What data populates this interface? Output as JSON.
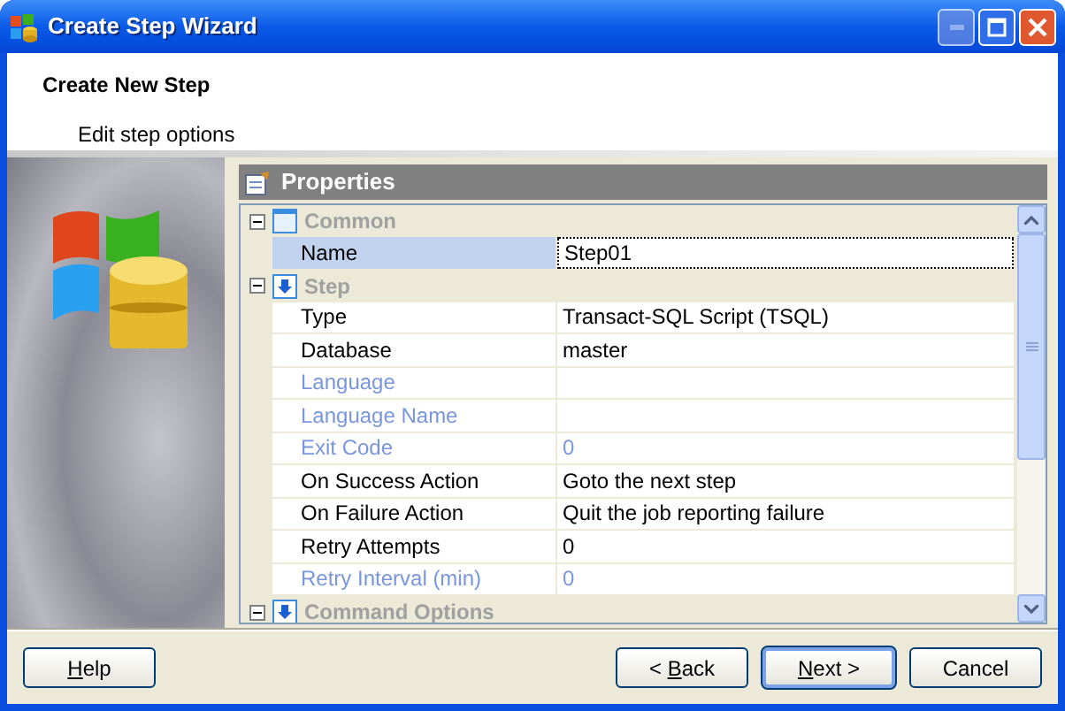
{
  "window": {
    "title": "Create Step Wizard",
    "title_buttons": [
      {
        "kind": "minimize",
        "disabled": true
      },
      {
        "kind": "maximize",
        "disabled": false
      },
      {
        "kind": "close",
        "disabled": false
      }
    ]
  },
  "header": {
    "title": "Create New Step",
    "subtitle": "Edit step options"
  },
  "properties": {
    "title": "Properties",
    "rows": [
      {
        "kind": "category",
        "label": "Common",
        "expanded": true
      },
      {
        "kind": "property",
        "label": "Name",
        "value": "Step01",
        "disabled": false,
        "selected": true
      },
      {
        "kind": "category",
        "label": "Step",
        "expanded": true
      },
      {
        "kind": "property",
        "label": "Type",
        "value": "Transact-SQL Script (TSQL)",
        "disabled": false,
        "selected": false
      },
      {
        "kind": "property",
        "label": "Database",
        "value": "master",
        "disabled": false,
        "selected": false
      },
      {
        "kind": "property",
        "label": "Language",
        "value": "",
        "disabled": true,
        "selected": false
      },
      {
        "kind": "property",
        "label": "Language Name",
        "value": "",
        "disabled": true,
        "selected": false
      },
      {
        "kind": "property",
        "label": "Exit Code",
        "value": "0",
        "disabled": true,
        "selected": false
      },
      {
        "kind": "property",
        "label": "On Success Action",
        "value": "Goto the next step",
        "disabled": false,
        "selected": false
      },
      {
        "kind": "property",
        "label": "On Failure Action",
        "value": "Quit the job reporting failure",
        "disabled": false,
        "selected": false
      },
      {
        "kind": "property",
        "label": "Retry Attempts",
        "value": "0",
        "disabled": false,
        "selected": false
      },
      {
        "kind": "property",
        "label": "Retry Interval (min)",
        "value": "0",
        "disabled": true,
        "selected": false
      },
      {
        "kind": "category",
        "label": "Command Options",
        "expanded": true
      }
    ]
  },
  "buttons": [
    {
      "label": "Help",
      "access_key_underlined": true,
      "default": false
    },
    {
      "label": "< Back",
      "access_key_underlined": true,
      "default": false
    },
    {
      "label": "Next >",
      "access_key_underlined": true,
      "default": true
    },
    {
      "label": "Cancel",
      "access_key_underlined": false,
      "default": false
    }
  ]
}
